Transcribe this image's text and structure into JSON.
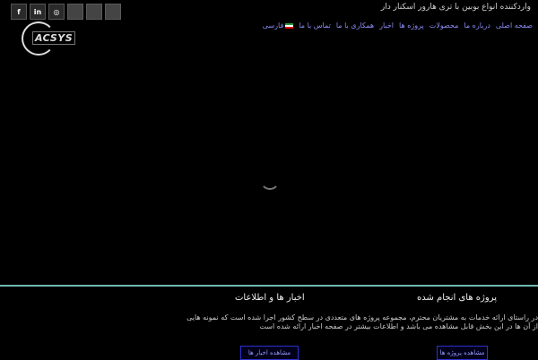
{
  "social": {
    "facebook_label": "f",
    "linkedin_label": "in",
    "instagram_label": "◎"
  },
  "header": {
    "tagline": "واردکننده انواع بوبین با تری هارور اسکنار دار",
    "logo_text": "ACSYS"
  },
  "nav": {
    "items": [
      "صفحه اصلی",
      "درباره ما",
      "محصولات",
      "پروژه ها",
      "اخبار",
      "همکاری با ما",
      "تماس با ما"
    ],
    "language_label": "فارسی"
  },
  "sections": {
    "projects_title": "پروژه های انجام شده",
    "news_title": "اخبار ها و اطلاعات",
    "description": "در راستای ارائه خدمات به مشتریان محترم، مجموعه پروژه های متعددی در سطح کشور اجرا شده است که نمونه هایی از آن ها در این بخش قابل مشاهده می باشد و اطلاعات بیشتر در صفحه اخبار ارائه شده است",
    "projects_button": "مشاهده پروژه ها",
    "news_button": "مشاهده اخبار ها"
  },
  "colors": {
    "background": "#000000",
    "nav_link": "#8b8bf5",
    "divider": "#6fb8b0",
    "button_border": "#3030d0"
  }
}
